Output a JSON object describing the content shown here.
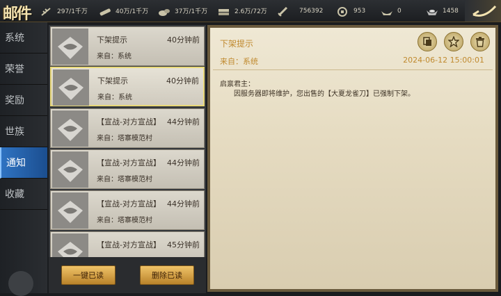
{
  "header": {
    "logo": "邮件",
    "resources": [
      {
        "icon": "grain-icon",
        "value": "297/1千万"
      },
      {
        "icon": "wood-icon",
        "value": "40万/1千万"
      },
      {
        "icon": "stone-icon",
        "value": "37万/1千万"
      },
      {
        "icon": "iron-icon",
        "value": "2.6万/72万"
      },
      {
        "icon": "sword-icon",
        "value": "756392"
      },
      {
        "icon": "copper-coin-icon",
        "value": "953"
      },
      {
        "icon": "gold-ingot-icon",
        "value": "0"
      },
      {
        "icon": "silver-ingot-icon",
        "value": "1458"
      }
    ]
  },
  "sidebar": {
    "tabs": [
      {
        "label": "系统"
      },
      {
        "label": "荣誉"
      },
      {
        "label": "奖励"
      },
      {
        "label": "世族"
      },
      {
        "label": "通知",
        "active": true
      },
      {
        "label": "收藏"
      }
    ]
  },
  "mail_list": [
    {
      "title": "下架提示",
      "time": "40分钟前",
      "from": "来自：系统"
    },
    {
      "title": "下架提示",
      "time": "40分钟前",
      "from": "来自：系统",
      "selected": true
    },
    {
      "title": "【宣战-对方宣战】",
      "time": "44分钟前",
      "from": "来自：塔寨模范村"
    },
    {
      "title": "【宣战-对方宣战】",
      "time": "44分钟前",
      "from": "来自：塔寨模范村"
    },
    {
      "title": "【宣战-对方宣战】",
      "time": "44分钟前",
      "from": "来自：塔寨模范村"
    },
    {
      "title": "【宣战-对方宣战】",
      "time": "45分钟前",
      "from": ""
    }
  ],
  "actions": {
    "read_all": "一键已读",
    "delete_read": "删除已读"
  },
  "detail": {
    "title": "下架提示",
    "from": "来自：系统",
    "date": "2024-06-12 15:00:01",
    "greeting": "启禀君主：",
    "body": "因服务器即将维护，您出售的【大夏龙雀刀】已强制下架。"
  },
  "colors": {
    "accent_gold": "#c08a2f",
    "active_tab": "#2f73c2",
    "button": "#e2b255"
  }
}
